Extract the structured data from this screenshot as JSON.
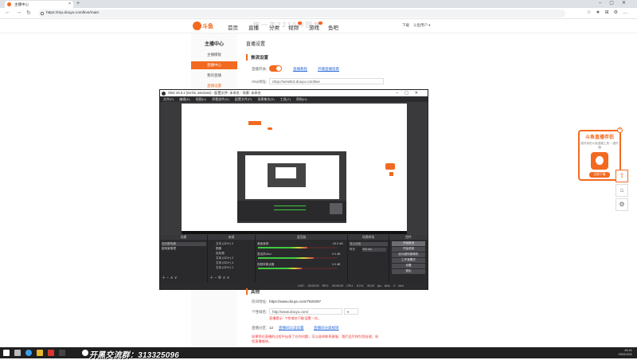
{
  "browser": {
    "tab_title": "主播中心",
    "url": "https://mp.douyu.com/live/main"
  },
  "header": {
    "logo_text": "斗鱼",
    "nav": [
      "首页",
      "直播",
      "分类",
      "视频",
      "游戏",
      "鱼吧"
    ],
    "right_items": [
      "下载",
      "斗鱼用户"
    ],
    "watermark": "按一次2210并回复"
  },
  "sidebar": {
    "title": "主播中心",
    "items": [
      "主播模板",
      "直播中心",
      "我的直播",
      "直播设置"
    ]
  },
  "settings": {
    "page_title": "直播设置",
    "section1": "推流设置",
    "toggle_label": "直播开关:",
    "link1": "直播教程",
    "link2": "开播直播指南",
    "rtmp_label": "rtmp地址:",
    "rtmp_value": "rtmp://sendtc3.douyu.com/live"
  },
  "obs": {
    "title": "OBS 26.0.2 (64-bit, windows) - 配置文件: 未命名 - 场景: 未命名",
    "menu": [
      "文件(F)",
      "编辑(E)",
      "视图(V)",
      "停靠部件(D)",
      "配置文件(P)",
      "场景集合(S)",
      "工具(T)",
      "帮助(H)"
    ],
    "docks": {
      "scenes": {
        "title": "场景",
        "items": [
          "四分屏场景",
          "副场景管理"
        ]
      },
      "sources": {
        "title": "来源",
        "items": [
          "文本 (GDI+) 3",
          "图像",
          "色彩源",
          "文本 (GDI+) 2",
          "文本 (GDI+) 4",
          "文本 (GDI+) 1"
        ]
      },
      "mixer": {
        "title": "混音器",
        "channels": [
          "桌面音频",
          "麦克风/Aux",
          "视频采集设备"
        ],
        "db": [
          "-26.0 dB",
          "0.0 dB",
          "0.0 dB"
        ]
      },
      "transitions": {
        "title": "场景转场",
        "value": "淡入淡出",
        "duration_label": "时长",
        "duration": "300 ms"
      },
      "controls": {
        "title": "控件",
        "buttons": [
          "开始推流",
          "开始录制",
          "启动虚拟摄像机",
          "工作室模式",
          "设置",
          "退出"
        ]
      }
    },
    "status": [
      "LIVE: 00:00:00",
      "REC: 00:00:00",
      "CPU: 8.1%, 30.00 fps",
      "kb/s: 0 kb/s"
    ]
  },
  "lower": {
    "section": "其他",
    "url_label": "房间地址:",
    "url_value": "https://www.douyu.com/7820297",
    "domain_label": "个性域名:",
    "domain_value": "http://www.douyu.com/",
    "domain_note": "直播提示: 个性域名只能设置一次。",
    "room_label": "直播分区:",
    "room_value": "12",
    "link_a": "直播间认证设置",
    "link_b": "直播间分类规则",
    "warn": "如果您在直播的过程中出现了任何问题，可以选择联系客服，我们会尽快为您处理，祝您直播愉快。"
  },
  "ad": {
    "title": "斗鱼直播伴侣",
    "sub": "超好用的斗鱼直播工具 一键开播",
    "button": "立即下载"
  },
  "taskbar": {
    "promo": "开黑交流群：313325096",
    "time": "16:41",
    "date": "2022/4/11"
  },
  "colors": {
    "brand": "#f26a21",
    "obs_bg": "#3a3a3d"
  }
}
